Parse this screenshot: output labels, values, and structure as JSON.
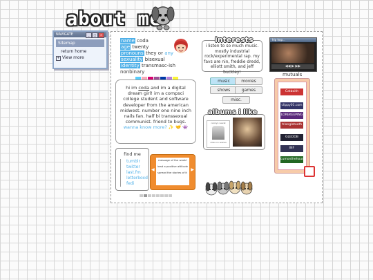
{
  "header": {
    "title": "about me"
  },
  "navigate_window": {
    "title": "NAVIGATE",
    "sitemap": "Sitemap",
    "links": [
      "return home",
      "View more"
    ]
  },
  "pronouns": {
    "rows": [
      {
        "label": "name",
        "value": "coda"
      },
      {
        "label": "age",
        "value": "twenty"
      },
      {
        "label": "pronouns",
        "value": "they or ",
        "value_highlight": "any"
      },
      {
        "label": "sexuality",
        "value": "bisexual"
      },
      {
        "label": "identity",
        "value": "transmasc-ish"
      },
      {
        "label": "",
        "value": "nonbinary"
      }
    ]
  },
  "flags_colors": [
    "#55cdfc",
    "#f7a8b8",
    "#d60270",
    "#9b4f96",
    "#0038a8",
    "#b57edc",
    "#fcf434"
  ],
  "interests": {
    "title": "interests",
    "text": "i listen to so much music. mostly industrial rock/experimental rap. my favs are nin, freddie dredd, elliott smith, and jeff buckley!"
  },
  "buttons": [
    "music",
    "movies",
    "shows",
    "games",
    "misc."
  ],
  "bio": {
    "pre": "hi im ",
    "name": "coda",
    "main": " and im a digital dream girl! im a compsci college student and software developer from the american midwest. number one nine inch nails fan. half bi transsexual communist. friend to bugs. ",
    "more": "wanna know more?",
    "emoji": "✨ 🤝 👾"
  },
  "albums": {
    "title": "albums i like",
    "caption": "carolyn velvet",
    "caption2": "cities on wishes"
  },
  "find_me": {
    "title": "find me",
    "links": [
      "tumblr",
      "twitter",
      "last.fm",
      "letterboxd",
      "fedi"
    ]
  },
  "orange_box": {
    "lines": [
      "message of the week!",
      "lead a positive attitude",
      "spread the stories of it"
    ]
  },
  "player": {
    "title": "hip hop..."
  },
  "mutuals": {
    "title": "mutuals",
    "items": [
      "Catboith",
      "clippy01.com",
      "LOREKEEPING",
      "triangletooth",
      "GLEDOB",
      "INF",
      "cumonthehouse"
    ]
  },
  "colors": {
    "accent_blue": "#4fb0e8",
    "orange": "#f08c2e",
    "mutuals_bg": "#f7cba9"
  }
}
